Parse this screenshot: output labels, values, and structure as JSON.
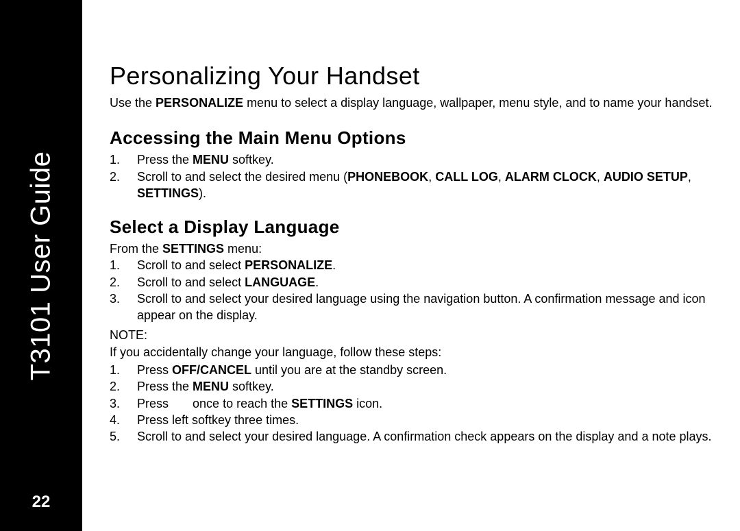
{
  "sidebar": {
    "title": "T3101 User Guide",
    "page_number": "22"
  },
  "content": {
    "heading": "Personalizing Your Handset",
    "intro_p1": "Use the ",
    "intro_bold1": "PERSONALIZE",
    "intro_p2": " menu to select a display language, wallpaper, menu style, and to name your handset.",
    "section1": {
      "heading": "Accessing the Main Menu Options",
      "items": [
        {
          "pre": "Press the ",
          "b1": "MENU",
          "post": " softkey."
        },
        {
          "pre": "Scroll to and select the desired menu (",
          "b1": "PHONEBOOK",
          "sep1": ", ",
          "b2": "CALL LOG",
          "sep2": ", ",
          "b3": "ALARM CLOCK",
          "sep3": ", ",
          "b4": "AUDIO SETUP",
          "sep4": ", ",
          "b5": "SETTINGS",
          "post": ")."
        }
      ]
    },
    "section2": {
      "heading": "Select a Display Language",
      "from_pre": "From the ",
      "from_bold": "SETTINGS",
      "from_post": " menu:",
      "items": [
        {
          "pre": "Scroll to and select ",
          "b1": "PERSONALIZE",
          "post": "."
        },
        {
          "pre": "Scroll to and select ",
          "b1": "LANGUAGE",
          "post": "."
        },
        {
          "pre": "Scroll to and select your desired language using the navigation button. A confirmation message and icon appear on the display.",
          "b1": "",
          "post": ""
        }
      ],
      "note_label": "NOTE:",
      "note_text": "If you accidentally change your language, follow these steps:",
      "note_items": [
        {
          "pre": "Press ",
          "b1": "OFF/CANCEL",
          "post": " until you are at the standby screen."
        },
        {
          "pre": "Press the ",
          "b1": "MENU",
          "post": " softkey."
        },
        {
          "pre": "Press ",
          "gap": "      ",
          "mid": "once to reach the ",
          "b1": "SETTINGS",
          "post": " icon."
        },
        {
          "pre": "Press left softkey three times.",
          "b1": "",
          "post": ""
        },
        {
          "pre": "Scroll to and select your desired language. A confirmation check appears on the display and a note plays.",
          "b1": "",
          "post": ""
        }
      ]
    }
  }
}
